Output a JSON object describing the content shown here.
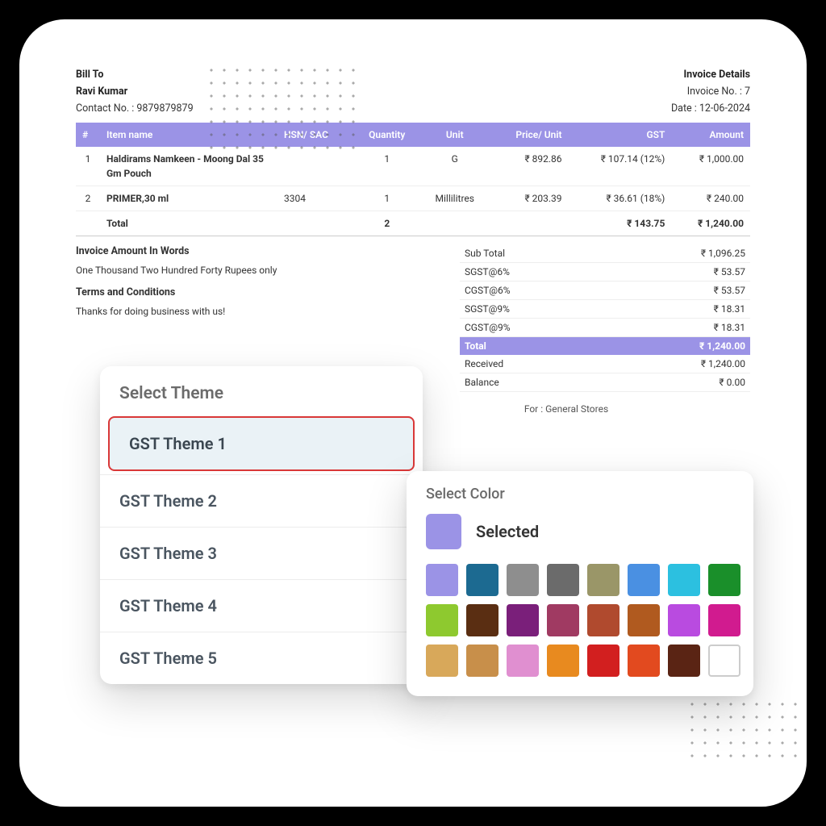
{
  "invoice": {
    "billto_label": "Bill To",
    "customer_name": "Ravi Kumar",
    "contact_label": "Contact No. : 9879879879",
    "details_label": "Invoice Details",
    "invoice_no": "Invoice No. : 7",
    "invoice_date": "Date : 12-06-2024",
    "columns": {
      "idx": "#",
      "item": "Item name",
      "hsn": "HSN/ SAC",
      "qty": "Quantity",
      "unit": "Unit",
      "price": "Price/ Unit",
      "gst": "GST",
      "amount": "Amount"
    },
    "rows": [
      {
        "idx": "1",
        "item": "Haldirams Namkeen - Moong Dal 35 Gm Pouch",
        "hsn": "",
        "qty": "1",
        "unit": "G",
        "price": "₹ 892.86",
        "gst": "₹ 107.14 (12%)",
        "amount": "₹ 1,000.00"
      },
      {
        "idx": "2",
        "item": "PRIMER,30 ml",
        "hsn": "3304",
        "qty": "1",
        "unit": "Millilitres",
        "price": "₹ 203.39",
        "gst": "₹ 36.61 (18%)",
        "amount": "₹ 240.00"
      }
    ],
    "total_row": {
      "label": "Total",
      "qty": "2",
      "gst": "₹ 143.75",
      "amount": "₹ 1,240.00"
    },
    "words_label": "Invoice Amount In Words",
    "words": "One Thousand Two Hundred Forty Rupees only",
    "terms_label": "Terms and Conditions",
    "terms": "Thanks for doing business with us!",
    "summary": [
      {
        "label": "Sub Total",
        "value": "₹ 1,096.25"
      },
      {
        "label": "SGST@6%",
        "value": "₹ 53.57"
      },
      {
        "label": "CGST@6%",
        "value": "₹ 53.57"
      },
      {
        "label": "SGST@9%",
        "value": "₹ 18.31"
      },
      {
        "label": "CGST@9%",
        "value": "₹ 18.31"
      }
    ],
    "summary_total": {
      "label": "Total",
      "value": "₹ 1,240.00"
    },
    "summary_tail": [
      {
        "label": "Received",
        "value": "₹ 1,240.00"
      },
      {
        "label": "Balance",
        "value": "₹ 0.00"
      }
    ],
    "for_line": "For : General Stores"
  },
  "theme_selector": {
    "title": "Select Theme",
    "items": [
      {
        "label": "GST Theme 1",
        "selected": true
      },
      {
        "label": "GST Theme 2",
        "selected": false
      },
      {
        "label": "GST Theme 3",
        "selected": false
      },
      {
        "label": "GST Theme 4",
        "selected": false
      },
      {
        "label": "GST Theme 5",
        "selected": false
      }
    ]
  },
  "color_selector": {
    "title": "Select Color",
    "selected_label": "Selected",
    "selected_color": "#9b93e6",
    "swatches": [
      "#9b93e6",
      "#1c6a91",
      "#8e8e8e",
      "#6b6b6b",
      "#9a9668",
      "#4a90e2",
      "#2cc0e0",
      "#1a8f2a",
      "#8ec92f",
      "#5a2e12",
      "#7a1f7a",
      "#a03a62",
      "#b04a2e",
      "#b05a1f",
      "#b94be0",
      "#d11b8f",
      "#d8a85a",
      "#c88f4a",
      "#e08fd0",
      "#e88a1f",
      "#d21f1f",
      "#e24a1f",
      "#5a2414",
      "#ffffff"
    ]
  }
}
